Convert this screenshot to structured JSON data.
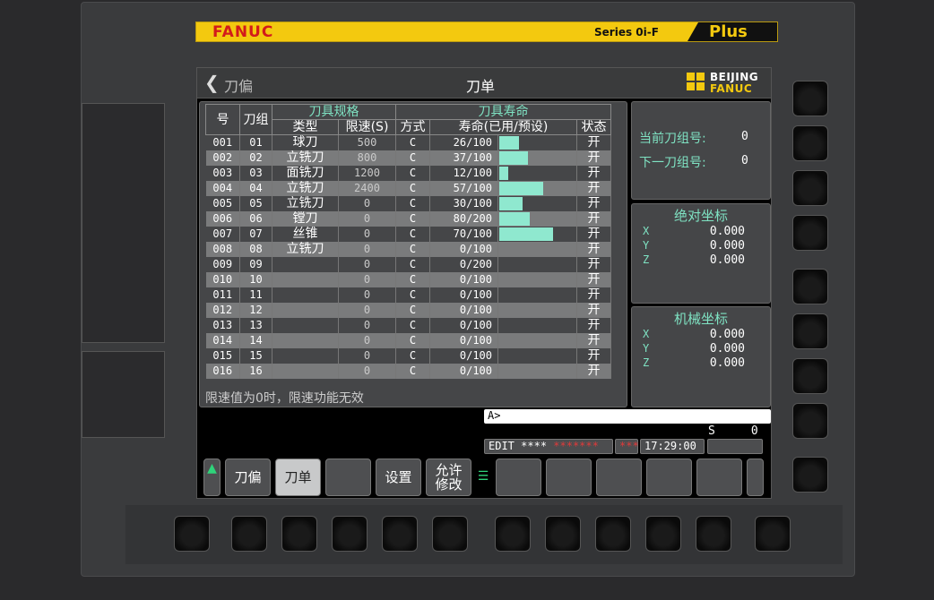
{
  "banner": {
    "brand": "FANUC",
    "series": "Series 0i-F",
    "plus": "Plus"
  },
  "logo": {
    "line1": "BEIJING",
    "line2": "FANUC"
  },
  "topbar": {
    "back_label": "刀偏",
    "title": "刀单"
  },
  "table": {
    "headers": {
      "no": "号",
      "group": "刀组",
      "spec": "刀具规格",
      "life": "刀具寿命",
      "type": "类型",
      "speed": "限速(S)",
      "mode": "方式",
      "life_detail": "寿命(已用/预设)",
      "state": "状态"
    },
    "rows": [
      {
        "no": "001",
        "group": "01",
        "type": "球刀",
        "speed": "500",
        "mode": "C",
        "life": "26/100",
        "fill": 0.26,
        "state": "开"
      },
      {
        "no": "002",
        "group": "02",
        "type": "立铣刀",
        "speed": "800",
        "mode": "C",
        "life": "37/100",
        "fill": 0.37,
        "state": "开"
      },
      {
        "no": "003",
        "group": "03",
        "type": "面铣刀",
        "speed": "1200",
        "mode": "C",
        "life": "12/100",
        "fill": 0.12,
        "state": "开"
      },
      {
        "no": "004",
        "group": "04",
        "type": "立铣刀",
        "speed": "2400",
        "mode": "C",
        "life": "57/100",
        "fill": 0.57,
        "state": "开"
      },
      {
        "no": "005",
        "group": "05",
        "type": "立铣刀",
        "speed": "0",
        "mode": "C",
        "life": "30/100",
        "fill": 0.3,
        "state": "开"
      },
      {
        "no": "006",
        "group": "06",
        "type": "镗刀",
        "speed": "0",
        "mode": "C",
        "life": "80/200",
        "fill": 0.4,
        "state": "开"
      },
      {
        "no": "007",
        "group": "07",
        "type": "丝锥",
        "speed": "0",
        "mode": "C",
        "life": "70/100",
        "fill": 0.7,
        "state": "开"
      },
      {
        "no": "008",
        "group": "08",
        "type": "立铣刀",
        "speed": "0",
        "mode": "C",
        "life": "0/100",
        "fill": 0,
        "state": "开"
      },
      {
        "no": "009",
        "group": "09",
        "type": "",
        "speed": "0",
        "mode": "C",
        "life": "0/200",
        "fill": 0,
        "state": "开"
      },
      {
        "no": "010",
        "group": "10",
        "type": "",
        "speed": "0",
        "mode": "C",
        "life": "0/100",
        "fill": 0,
        "state": "开"
      },
      {
        "no": "011",
        "group": "11",
        "type": "",
        "speed": "0",
        "mode": "C",
        "life": "0/100",
        "fill": 0,
        "state": "开"
      },
      {
        "no": "012",
        "group": "12",
        "type": "",
        "speed": "0",
        "mode": "C",
        "life": "0/100",
        "fill": 0,
        "state": "开"
      },
      {
        "no": "013",
        "group": "13",
        "type": "",
        "speed": "0",
        "mode": "C",
        "life": "0/100",
        "fill": 0,
        "state": "开"
      },
      {
        "no": "014",
        "group": "14",
        "type": "",
        "speed": "0",
        "mode": "C",
        "life": "0/100",
        "fill": 0,
        "state": "开"
      },
      {
        "no": "015",
        "group": "15",
        "type": "",
        "speed": "0",
        "mode": "C",
        "life": "0/100",
        "fill": 0,
        "state": "开"
      },
      {
        "no": "016",
        "group": "16",
        "type": "",
        "speed": "0",
        "mode": "C",
        "life": "0/100",
        "fill": 0,
        "state": "开"
      }
    ],
    "note": "限速值为0时，限速功能无效"
  },
  "group_panel": {
    "current_label": "当前刀组号:",
    "current_value": "0",
    "next_label": "下一刀组号:",
    "next_value": "0"
  },
  "abs_panel": {
    "title": "绝对坐标",
    "axes": [
      {
        "axis": "X",
        "value": "0.000"
      },
      {
        "axis": "Y",
        "value": "0.000"
      },
      {
        "axis": "Z",
        "value": "0.000"
      }
    ]
  },
  "mach_panel": {
    "title": "机械坐标",
    "axes": [
      {
        "axis": "X",
        "value": "0.000"
      },
      {
        "axis": "Y",
        "value": "0.000"
      },
      {
        "axis": "Z",
        "value": "0.000"
      }
    ]
  },
  "command": {
    "prompt": "A>"
  },
  "spindle": {
    "label": "S",
    "value": "0"
  },
  "status": {
    "mode": "EDIT",
    "stars": "****",
    "alarm": "*******",
    "alarm2": "***",
    "time": "17:29:00"
  },
  "softkeys": {
    "k1": "刀偏",
    "k2": "刀单",
    "k3": "",
    "k4": "设置",
    "k5_line1": "允许",
    "k5_line2": "修改"
  },
  "colors": {
    "accent": "#7fe3c3",
    "bar": "#8fe8cf",
    "banner": "#f3c90f",
    "brand_red": "#d21b1b"
  }
}
